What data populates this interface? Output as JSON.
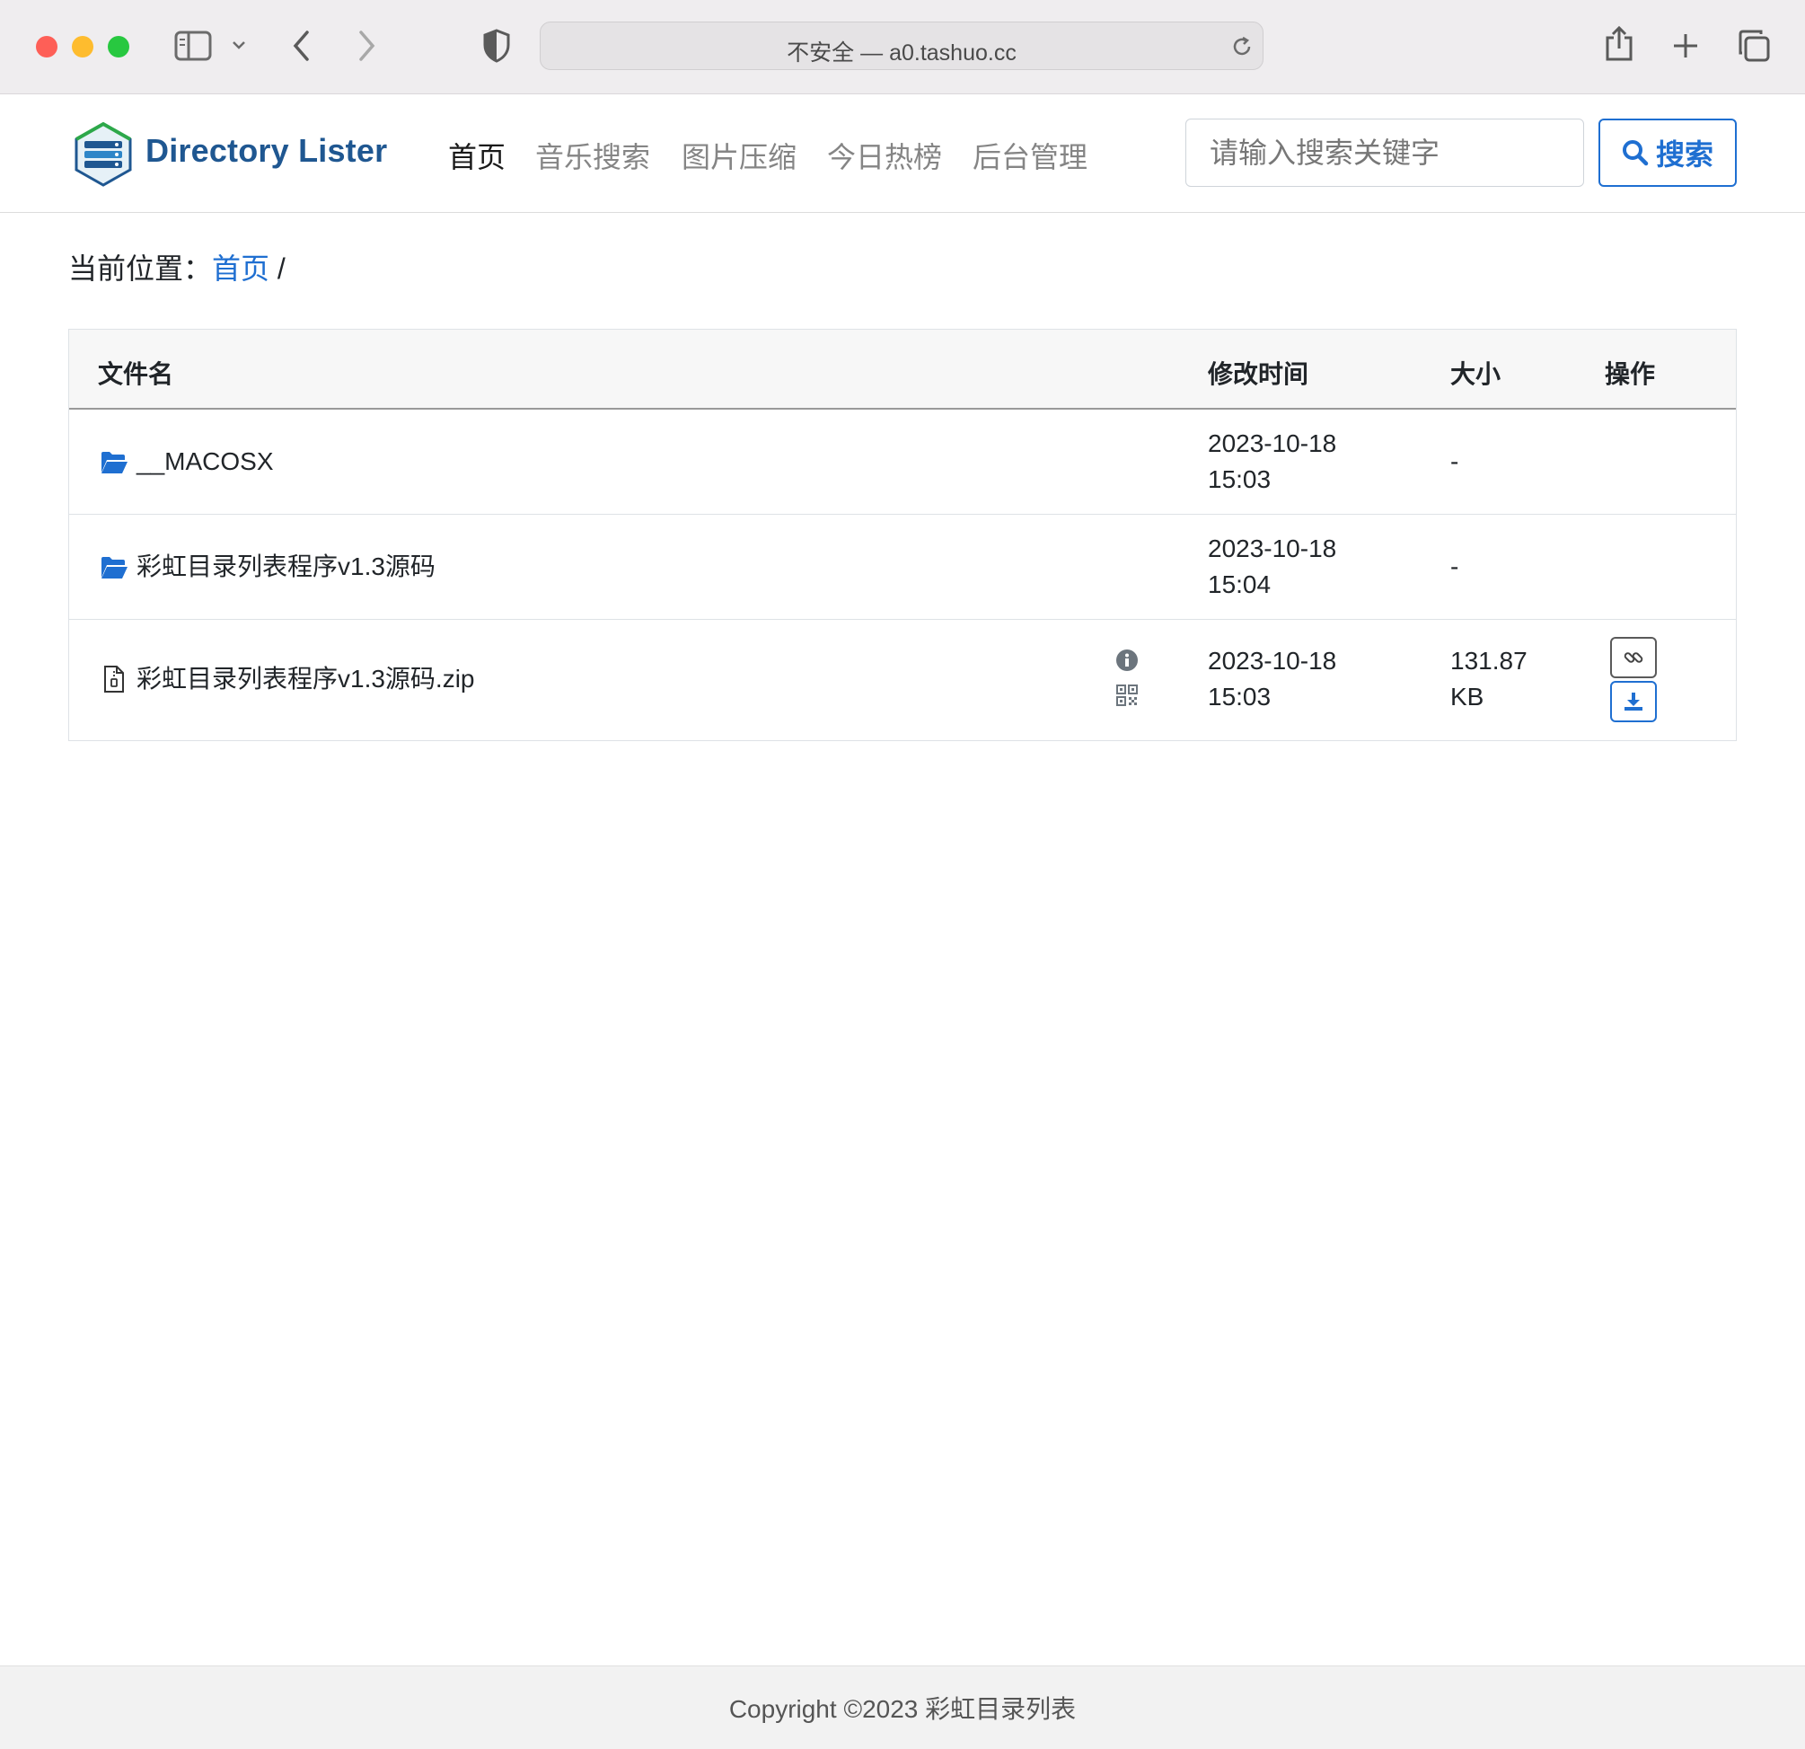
{
  "browser": {
    "url_text": "不安全 — a0.tashuo.cc",
    "traffic_colors": {
      "close": "#fe5f57",
      "minimize": "#febc2e",
      "maximize": "#28c840"
    }
  },
  "navbar": {
    "brand": "Directory Lister",
    "links": [
      "首页",
      "音乐搜索",
      "图片压缩",
      "今日热榜",
      "后台管理"
    ],
    "active_link": "首页",
    "search_placeholder": "请输入搜索关键字",
    "search_button": "搜索"
  },
  "breadcrumb": {
    "label": "当前位置：",
    "home": "首页",
    "separator": "/"
  },
  "table": {
    "headers": {
      "name": "文件名",
      "modified": "修改时间",
      "size": "大小",
      "actions": "操作"
    },
    "rows": [
      {
        "type": "folder",
        "name": "__MACOSX",
        "date": "2023-10-18",
        "time": "15:03",
        "size": "-",
        "size_unit": ""
      },
      {
        "type": "folder",
        "name": "彩虹目录列表程序v1.3源码",
        "date": "2023-10-18",
        "time": "15:04",
        "size": "-",
        "size_unit": ""
      },
      {
        "type": "file",
        "name": "彩虹目录列表程序v1.3源码.zip",
        "date": "2023-10-18",
        "time": "15:03",
        "size": "131.87",
        "size_unit": "KB"
      }
    ]
  },
  "footer": {
    "copyright": "Copyright ©2023 彩虹目录列表"
  },
  "colors": {
    "accent": "#1f6fd1",
    "brand": "#1f5791"
  }
}
